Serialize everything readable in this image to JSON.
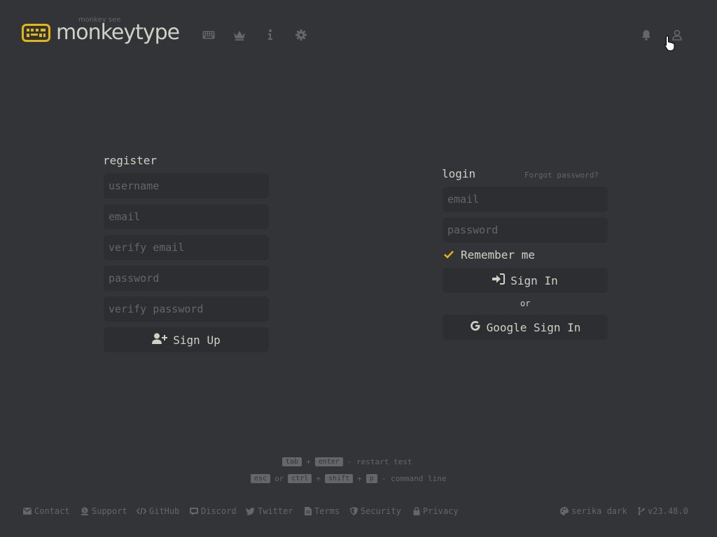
{
  "header": {
    "logo_subtitle": "monkey see",
    "logo_title": "monkeytype",
    "nav_icons": [
      "keyboard-icon",
      "crown-icon",
      "info-icon",
      "gear-icon"
    ],
    "right_icons": [
      "bell-icon",
      "user-icon"
    ]
  },
  "register": {
    "title": "register",
    "username_placeholder": "username",
    "email_placeholder": "email",
    "verify_email_placeholder": "verify email",
    "password_placeholder": "password",
    "verify_password_placeholder": "verify password",
    "signup_label": "Sign Up"
  },
  "login": {
    "title": "login",
    "forgot_label": "Forgot password?",
    "email_placeholder": "email",
    "password_placeholder": "password",
    "remember_label": "Remember me",
    "signin_label": "Sign In",
    "or_label": "or",
    "google_label": "Google Sign In"
  },
  "hints": {
    "line1": {
      "key1": "tab",
      "plus": "+",
      "key2": "enter",
      "desc": "- restart test"
    },
    "line2": {
      "key1": "esc",
      "or": "or",
      "key2": "ctrl",
      "plus1": "+",
      "key3": "shift",
      "plus2": "+",
      "key4": "p",
      "desc": "- command line"
    }
  },
  "footer": {
    "contact": "Contact",
    "support": "Support",
    "github": "GitHub",
    "discord": "Discord",
    "twitter": "Twitter",
    "terms": "Terms",
    "security": "Security",
    "privacy": "Privacy",
    "theme": "serika dark",
    "version": "v23.48.0"
  },
  "colors": {
    "background": "#323437",
    "accent": "#e2b714",
    "text": "#d1d0c5",
    "sub": "#646669",
    "field_bg": "#2c2e31"
  }
}
